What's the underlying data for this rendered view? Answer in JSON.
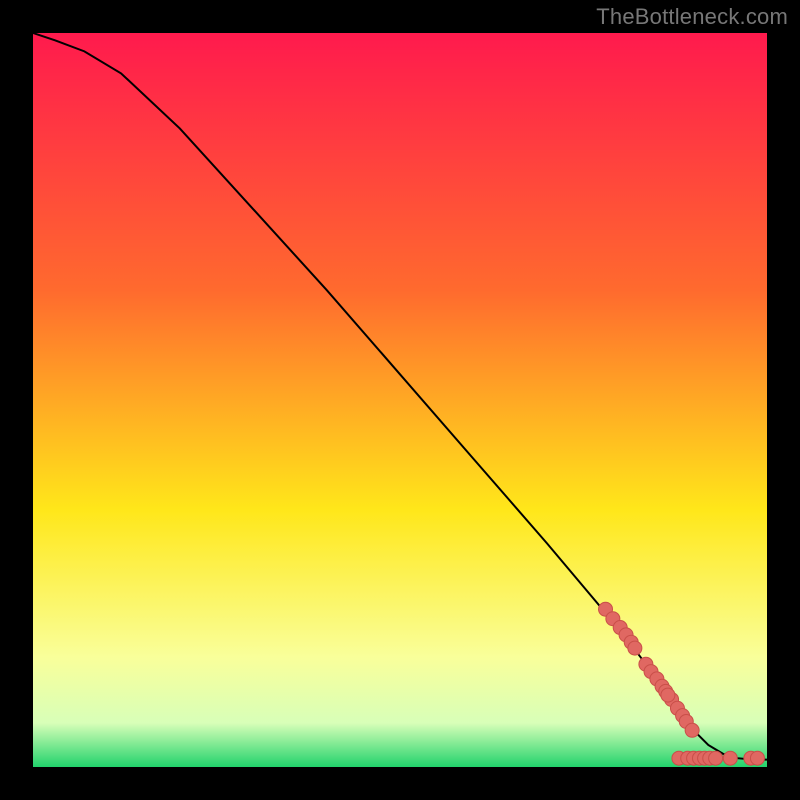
{
  "watermark": "TheBottleneck.com",
  "colors": {
    "background_black": "#000000",
    "gradient_top": "#ff1a4d",
    "gradient_mid1": "#ff6a2e",
    "gradient_mid2": "#ffe71a",
    "gradient_mid3": "#f9ff9a",
    "gradient_bottom_upper": "#d8ffb8",
    "gradient_bottom": "#22d36c",
    "curve": "#000000",
    "marker_fill": "#e06862",
    "marker_stroke": "#c94f49"
  },
  "chart_data": {
    "type": "line",
    "title": "",
    "xlabel": "",
    "ylabel": "",
    "xlim": [
      0,
      100
    ],
    "ylim": [
      0,
      100
    ],
    "grid": false,
    "legend": false,
    "series": [
      {
        "name": "curve",
        "kind": "line",
        "x": [
          0,
          3,
          7,
          12,
          20,
          30,
          40,
          50,
          60,
          70,
          78,
          82,
          85,
          88,
          90,
          92,
          94,
          96,
          98,
          100
        ],
        "y": [
          100,
          99,
          97.5,
          94.5,
          87,
          76,
          65,
          53.5,
          42,
          30.5,
          21,
          16,
          12,
          8,
          5,
          3,
          1.8,
          1.2,
          1,
          1
        ]
      },
      {
        "name": "markers",
        "kind": "scatter",
        "points": [
          {
            "x": 78,
            "y": 21.5
          },
          {
            "x": 79,
            "y": 20.2
          },
          {
            "x": 80,
            "y": 19
          },
          {
            "x": 80.8,
            "y": 18
          },
          {
            "x": 81.5,
            "y": 17
          },
          {
            "x": 82,
            "y": 16.2
          },
          {
            "x": 83.5,
            "y": 14
          },
          {
            "x": 84.2,
            "y": 13
          },
          {
            "x": 85,
            "y": 12
          },
          {
            "x": 85.7,
            "y": 11
          },
          {
            "x": 86.2,
            "y": 10.3
          },
          {
            "x": 87,
            "y": 9.2
          },
          {
            "x": 87.8,
            "y": 8
          },
          {
            "x": 88.5,
            "y": 7
          },
          {
            "x": 89,
            "y": 6.2
          },
          {
            "x": 89.8,
            "y": 5
          },
          {
            "x": 86.5,
            "y": 9.8
          },
          {
            "x": 88,
            "y": 1.2
          },
          {
            "x": 89.2,
            "y": 1.2
          },
          {
            "x": 90,
            "y": 1.2
          },
          {
            "x": 90.8,
            "y": 1.2
          },
          {
            "x": 91.5,
            "y": 1.2
          },
          {
            "x": 92.2,
            "y": 1.2
          },
          {
            "x": 93,
            "y": 1.2
          },
          {
            "x": 95,
            "y": 1.2
          },
          {
            "x": 97.8,
            "y": 1.2
          },
          {
            "x": 98.7,
            "y": 1.2
          }
        ]
      }
    ]
  }
}
